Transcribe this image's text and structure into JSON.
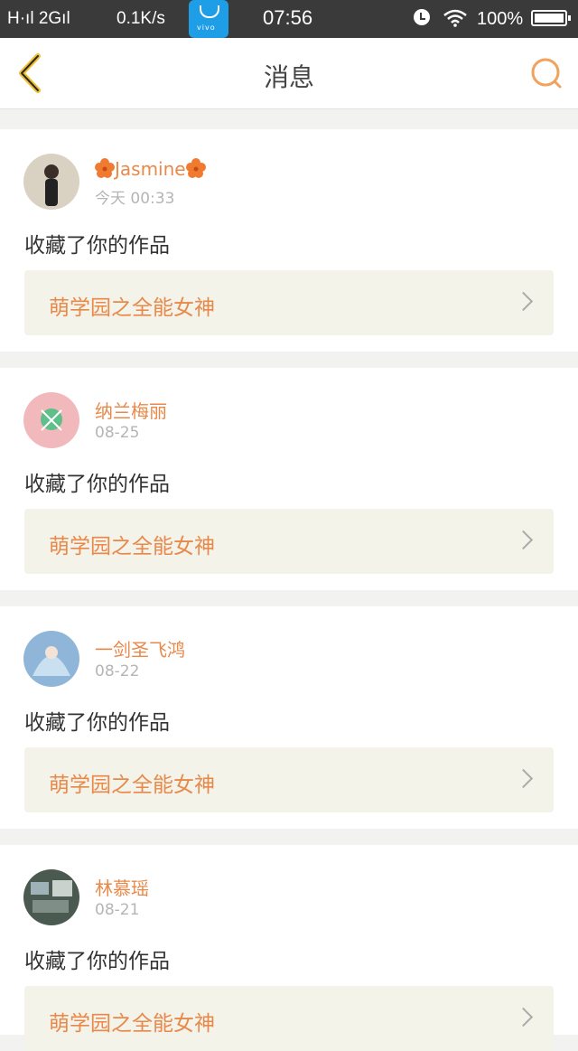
{
  "status_bar": {
    "signal": "H·ıl 2Gıl",
    "speed": "0.1K/s",
    "time": "07:56",
    "battery": "100%",
    "vivo_label": "vivo"
  },
  "nav": {
    "title": "消息",
    "back_icon": "back-chevron-icon",
    "search_icon": "search-icon"
  },
  "messages": [
    {
      "user": "Jasmine",
      "date": "今天 00:33",
      "action": "收藏了你的作品",
      "work": "萌学园之全能女神",
      "avatar_color": "#d9d2c2"
    },
    {
      "user": "纳兰梅丽",
      "date": "08-25",
      "action": "收藏了你的作品",
      "work": "萌学园之全能女神",
      "avatar_color": "#f2b9bd"
    },
    {
      "user": "一剑圣飞鸿",
      "date": "08-22",
      "action": "收藏了你的作品",
      "work": "萌学园之全能女神",
      "avatar_color": "#8fb6d8"
    },
    {
      "user": "林慕瑶",
      "date": "08-21",
      "action": "收藏了你的作品",
      "work": "萌学园之全能女神",
      "avatar_color": "#4a5a50"
    }
  ],
  "colors": {
    "accent": "#e8894a",
    "back_icon": "#f0c030",
    "status_bar": "#3a3a3a"
  }
}
